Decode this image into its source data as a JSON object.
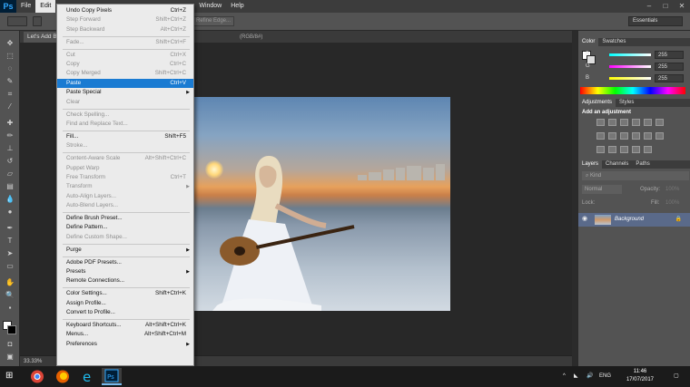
{
  "app": {
    "logo": "Ps",
    "menus": [
      "File",
      "Edit",
      "Window",
      "Help"
    ],
    "active_menu": "Edit"
  },
  "options": {
    "refine_edge": "Refine Edge...",
    "workspace": "Essentials"
  },
  "document": {
    "tab_title": "Let's Add B",
    "tab_info": "(RGB/8#)",
    "zoom": "33.33%"
  },
  "edit_menu": [
    {
      "label": "Undo Copy Pixels",
      "shortcut": "Ctrl+Z",
      "enabled": true
    },
    {
      "label": "Step Forward",
      "shortcut": "Shift+Ctrl+Z",
      "enabled": false
    },
    {
      "label": "Step Backward",
      "shortcut": "Alt+Ctrl+Z",
      "enabled": false
    },
    {
      "sep": true
    },
    {
      "label": "Fade...",
      "shortcut": "Shift+Ctrl+F",
      "enabled": false
    },
    {
      "sep": true
    },
    {
      "label": "Cut",
      "shortcut": "Ctrl+X",
      "enabled": false
    },
    {
      "label": "Copy",
      "shortcut": "Ctrl+C",
      "enabled": false
    },
    {
      "label": "Copy Merged",
      "shortcut": "Shift+Ctrl+C",
      "enabled": false
    },
    {
      "label": "Paste",
      "shortcut": "Ctrl+V",
      "enabled": true,
      "highlight": true
    },
    {
      "label": "Paste Special",
      "shortcut": "",
      "enabled": true,
      "submenu": true
    },
    {
      "label": "Clear",
      "shortcut": "",
      "enabled": false
    },
    {
      "sep": true
    },
    {
      "label": "Check Spelling...",
      "shortcut": "",
      "enabled": false
    },
    {
      "label": "Find and Replace Text...",
      "shortcut": "",
      "enabled": false
    },
    {
      "sep": true
    },
    {
      "label": "Fill...",
      "shortcut": "Shift+F5",
      "enabled": true
    },
    {
      "label": "Stroke...",
      "shortcut": "",
      "enabled": false
    },
    {
      "sep": true
    },
    {
      "label": "Content-Aware Scale",
      "shortcut": "Alt+Shift+Ctrl+C",
      "enabled": false
    },
    {
      "label": "Puppet Warp",
      "shortcut": "",
      "enabled": false
    },
    {
      "label": "Free Transform",
      "shortcut": "Ctrl+T",
      "enabled": false
    },
    {
      "label": "Transform",
      "shortcut": "",
      "enabled": false,
      "submenu": true
    },
    {
      "label": "Auto-Align Layers...",
      "shortcut": "",
      "enabled": false
    },
    {
      "label": "Auto-Blend Layers...",
      "shortcut": "",
      "enabled": false
    },
    {
      "sep": true
    },
    {
      "label": "Define Brush Preset...",
      "shortcut": "",
      "enabled": true
    },
    {
      "label": "Define Pattern...",
      "shortcut": "",
      "enabled": true
    },
    {
      "label": "Define Custom Shape...",
      "shortcut": "",
      "enabled": false
    },
    {
      "sep": true
    },
    {
      "label": "Purge",
      "shortcut": "",
      "enabled": true,
      "submenu": true
    },
    {
      "sep": true
    },
    {
      "label": "Adobe PDF Presets...",
      "shortcut": "",
      "enabled": true
    },
    {
      "label": "Presets",
      "shortcut": "",
      "enabled": true,
      "submenu": true
    },
    {
      "label": "Remote Connections...",
      "shortcut": "",
      "enabled": true
    },
    {
      "sep": true
    },
    {
      "label": "Color Settings...",
      "shortcut": "Shift+Ctrl+K",
      "enabled": true
    },
    {
      "label": "Assign Profile...",
      "shortcut": "",
      "enabled": true
    },
    {
      "label": "Convert to Profile...",
      "shortcut": "",
      "enabled": true
    },
    {
      "sep": true
    },
    {
      "label": "Keyboard Shortcuts...",
      "shortcut": "Alt+Shift+Ctrl+K",
      "enabled": true
    },
    {
      "label": "Menus...",
      "shortcut": "Alt+Shift+Ctrl+M",
      "enabled": true
    },
    {
      "label": "Preferences",
      "shortcut": "",
      "enabled": true,
      "submenu": true
    }
  ],
  "color_panel": {
    "tabs": [
      "Color",
      "Swatches"
    ],
    "channels": [
      {
        "label": "R",
        "value": "255",
        "color": "#ff3d3d"
      },
      {
        "label": "G",
        "value": "255",
        "color": "#3dff3d"
      },
      {
        "label": "B",
        "value": "255",
        "color": "#3d6dff"
      }
    ]
  },
  "adjustments_panel": {
    "tabs": [
      "Adjustments",
      "Styles"
    ],
    "title": "Add an adjustment"
  },
  "layers_panel": {
    "tabs": [
      "Layers",
      "Channels",
      "Paths"
    ],
    "kind": "Kind",
    "blend": "Normal",
    "opacity_label": "Opacity:",
    "opacity": "100%",
    "lock_label": "Lock:",
    "fill_label": "Fill:",
    "fill": "100%",
    "layer_name": "Background"
  },
  "taskbar": {
    "lang": "ENG",
    "time": "11:46",
    "date": "17/07/2017"
  }
}
